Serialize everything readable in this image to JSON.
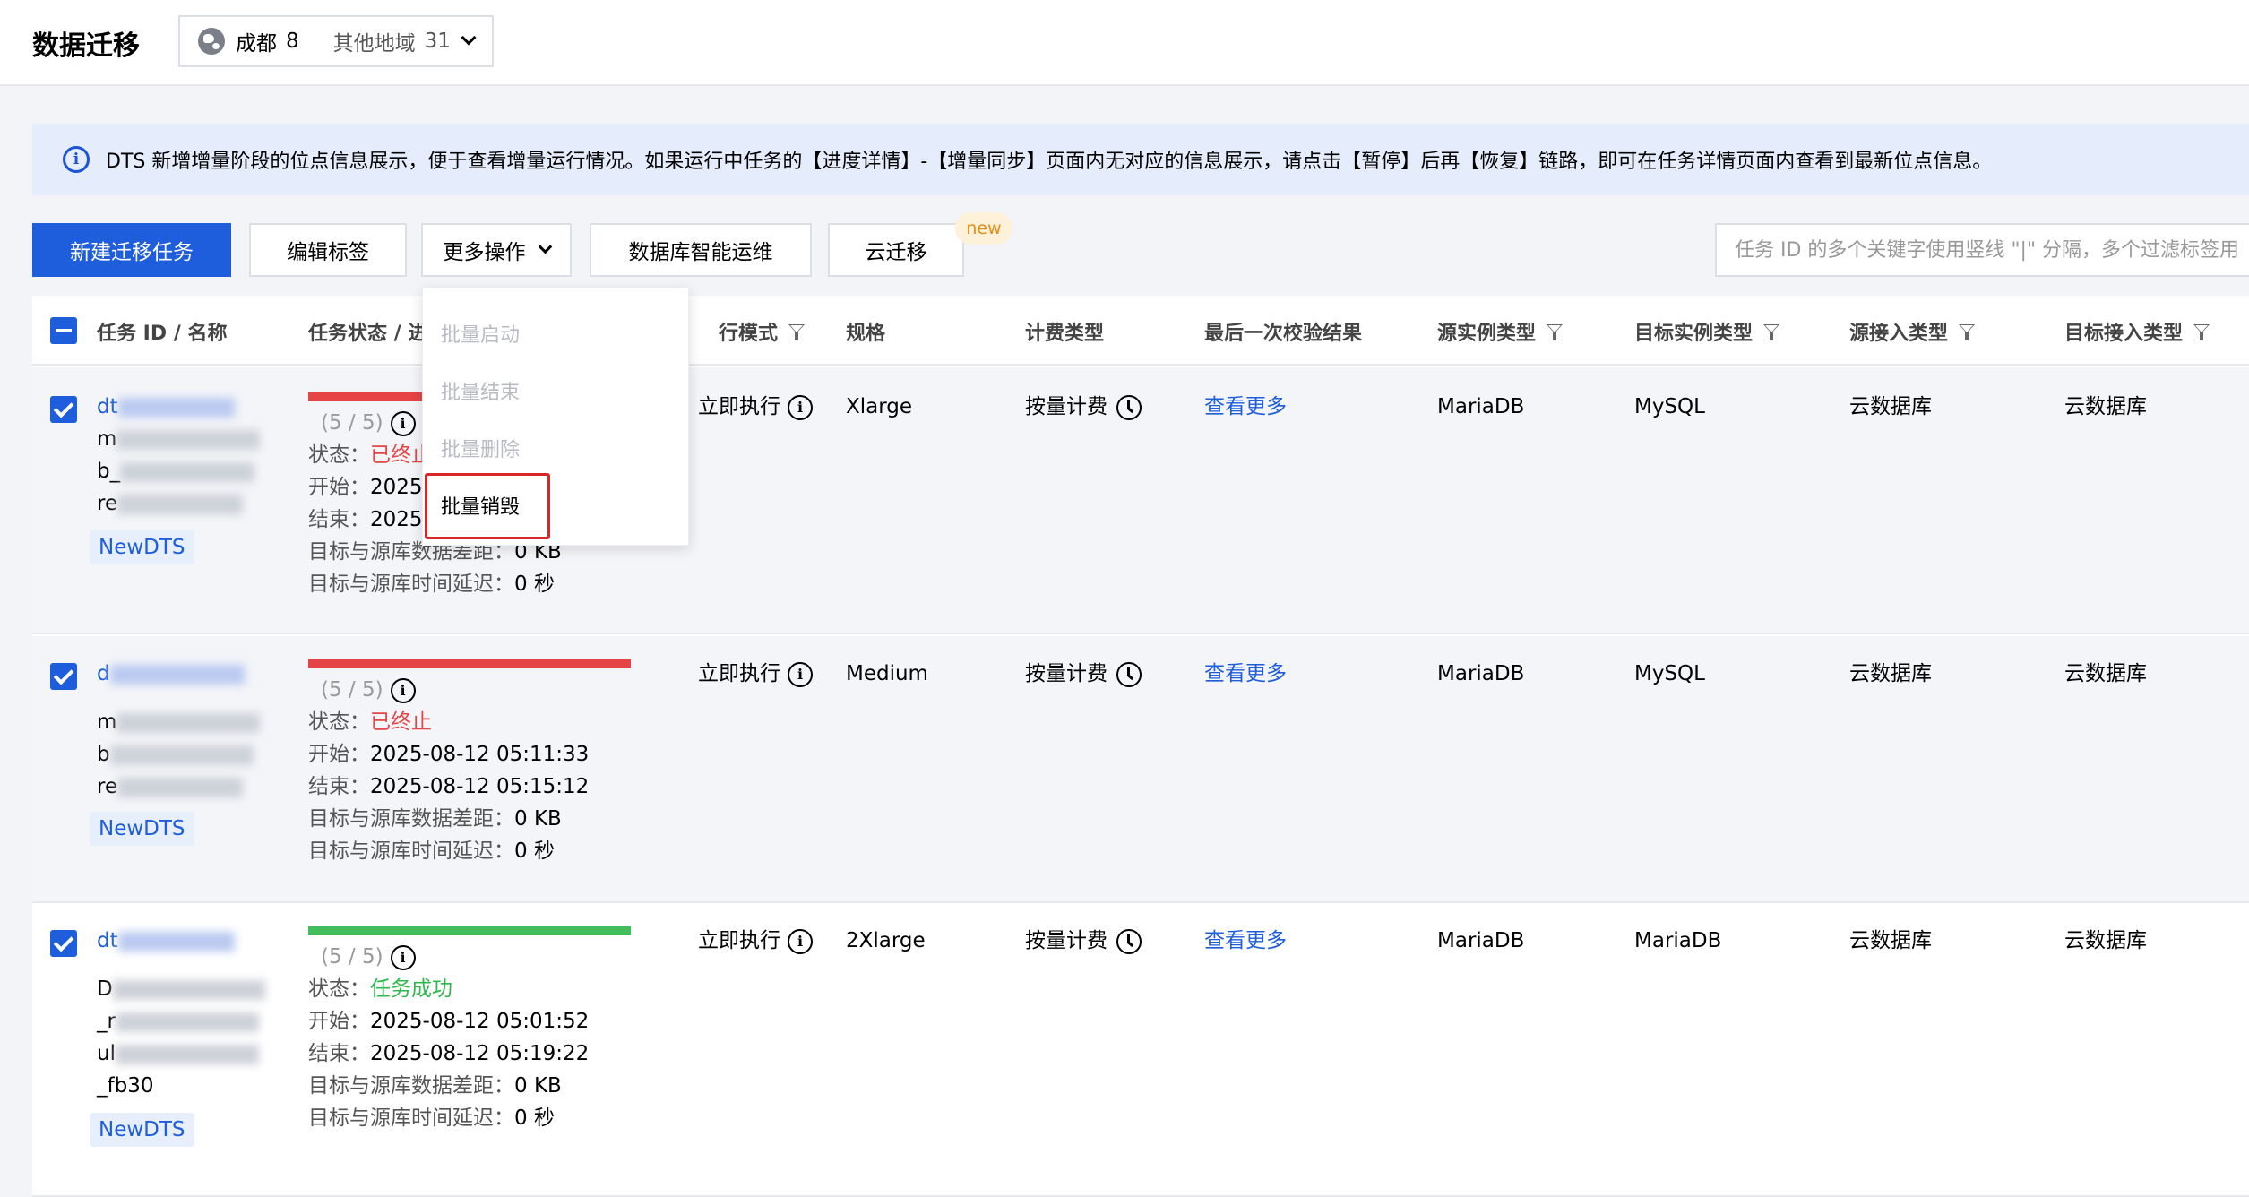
{
  "header": {
    "title": "数据迁移",
    "region": {
      "current": "成都",
      "current_count": "8",
      "other": "其他地域",
      "other_count": "31"
    }
  },
  "notice": {
    "text": "DTS 新增增量阶段的位点信息展示，便于查看增量运行情况。如果运行中任务的【进度详情】-【增量同步】页面内无对应的信息展示，请点击【暂停】后再【恢复】链路，即可在任务详情页面内查看到最新位点信息。"
  },
  "toolbar": {
    "new_task": "新建迁移任务",
    "edit_tags": "编辑标签",
    "more_actions": "更多操作",
    "db_ops": "数据库智能运维",
    "cloud_migrate": "云迁移",
    "new_badge": "new",
    "search_placeholder": "任务 ID 的多个关键字使用竖线 \"|\" 分隔，多个过滤标签用"
  },
  "dropdown": {
    "items": [
      "批量启动",
      "批量结束",
      "批量删除",
      "批量销毁"
    ]
  },
  "table": {
    "headers": {
      "id_name": "任务 ID / 名称",
      "status": "任务状态 / 进",
      "mode": "行模式",
      "spec": "规格",
      "billing": "计费类型",
      "last_check": "最后一次校验结果",
      "src_type": "源实例类型",
      "dst_type": "目标实例类型",
      "src_access": "源接入类型",
      "dst_access": "目标接入类型"
    },
    "labels": {
      "state": "状态：",
      "start": "开始：",
      "end": "结束：",
      "data_gap": "目标与源库数据差距：",
      "time_delay": "目标与源库时间延迟："
    },
    "rows": [
      {
        "id_prefix": "dt",
        "name_lines": [
          "m",
          "b_",
          "re"
        ],
        "tag": "NewDTS",
        "progress": "(5 / 5)",
        "state": "已终止",
        "start": "2025",
        "end": "2025",
        "data_gap": "0 KB",
        "time_delay": "0 秒",
        "mode": "立即执行",
        "spec": "Xlarge",
        "billing": "按量计费",
        "last_check": "查看更多",
        "src_type": "MariaDB",
        "dst_type": "MySQL",
        "src_access": "云数据库",
        "dst_access": "云数据库"
      },
      {
        "id_prefix": "d",
        "name_lines": [
          "m",
          "b",
          "re"
        ],
        "tag": "NewDTS",
        "progress": "(5 / 5)",
        "state": "已终止",
        "start": "2025-08-12 05:11:33",
        "end": "2025-08-12 05:15:12",
        "data_gap": "0 KB",
        "time_delay": "0 秒",
        "mode": "立即执行",
        "spec": "Medium",
        "billing": "按量计费",
        "last_check": "查看更多",
        "src_type": "MariaDB",
        "dst_type": "MySQL",
        "src_access": "云数据库",
        "dst_access": "云数据库"
      },
      {
        "id_prefix": "dt",
        "name_lines": [
          "D",
          "_r",
          "ul",
          "_fb30"
        ],
        "tag": "NewDTS",
        "progress": "(5 / 5)",
        "state": "任务成功",
        "start": "2025-08-12 05:01:52",
        "end": "2025-08-12 05:19:22",
        "data_gap": "0 KB",
        "time_delay": "0 秒",
        "mode": "立即执行",
        "spec": "2Xlarge",
        "billing": "按量计费",
        "last_check": "查看更多",
        "src_type": "MariaDB",
        "dst_type": "MariaDB",
        "src_access": "云数据库",
        "dst_access": "云数据库"
      }
    ]
  },
  "colors": {
    "primary": "#1e5ddb",
    "danger": "#e54545",
    "success": "#43be5d",
    "highlight": "#dd2525"
  }
}
